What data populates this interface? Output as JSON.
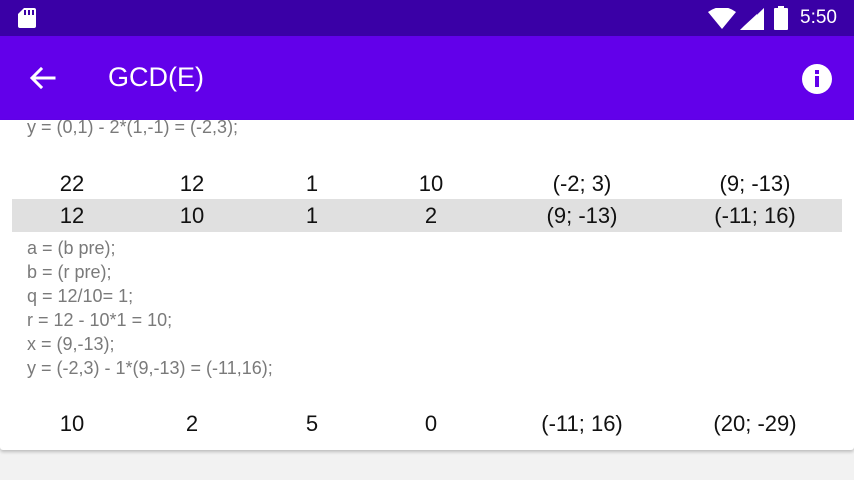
{
  "status_bar": {
    "time": "5:50",
    "icons": [
      "sd-card-icon",
      "wifi-icon",
      "signal-icon",
      "battery-icon"
    ]
  },
  "app_bar": {
    "title": "GCD(E)",
    "back_icon": "arrow-left-icon",
    "info_icon": "info-icon",
    "color": "#6200ea",
    "status_color": "#3a00a6"
  },
  "steps": [
    {
      "note": [
        "y = (0,1) - 2*(1,-1) = (-2,3);"
      ]
    },
    {
      "row": [
        "22",
        "12",
        "1",
        "10",
        "(-2; 3)",
        "(9; -13)"
      ],
      "highlighted": false
    },
    {
      "row": [
        "12",
        "10",
        "1",
        "2",
        "(9; -13)",
        "(-11; 16)"
      ],
      "highlighted": true
    },
    {
      "note": [
        "a = (b pre);",
        "b = (r pre);",
        "q = 12/10= 1;",
        "r = 12 - 10*1 = 10;",
        "x = (9,-13);",
        "y = (-2,3) - 1*(9,-13) = (-11,16);"
      ]
    },
    {
      "row": [
        "10",
        "2",
        "5",
        "0",
        "(-11; 16)",
        "(20; -29)"
      ],
      "highlighted": false
    }
  ]
}
